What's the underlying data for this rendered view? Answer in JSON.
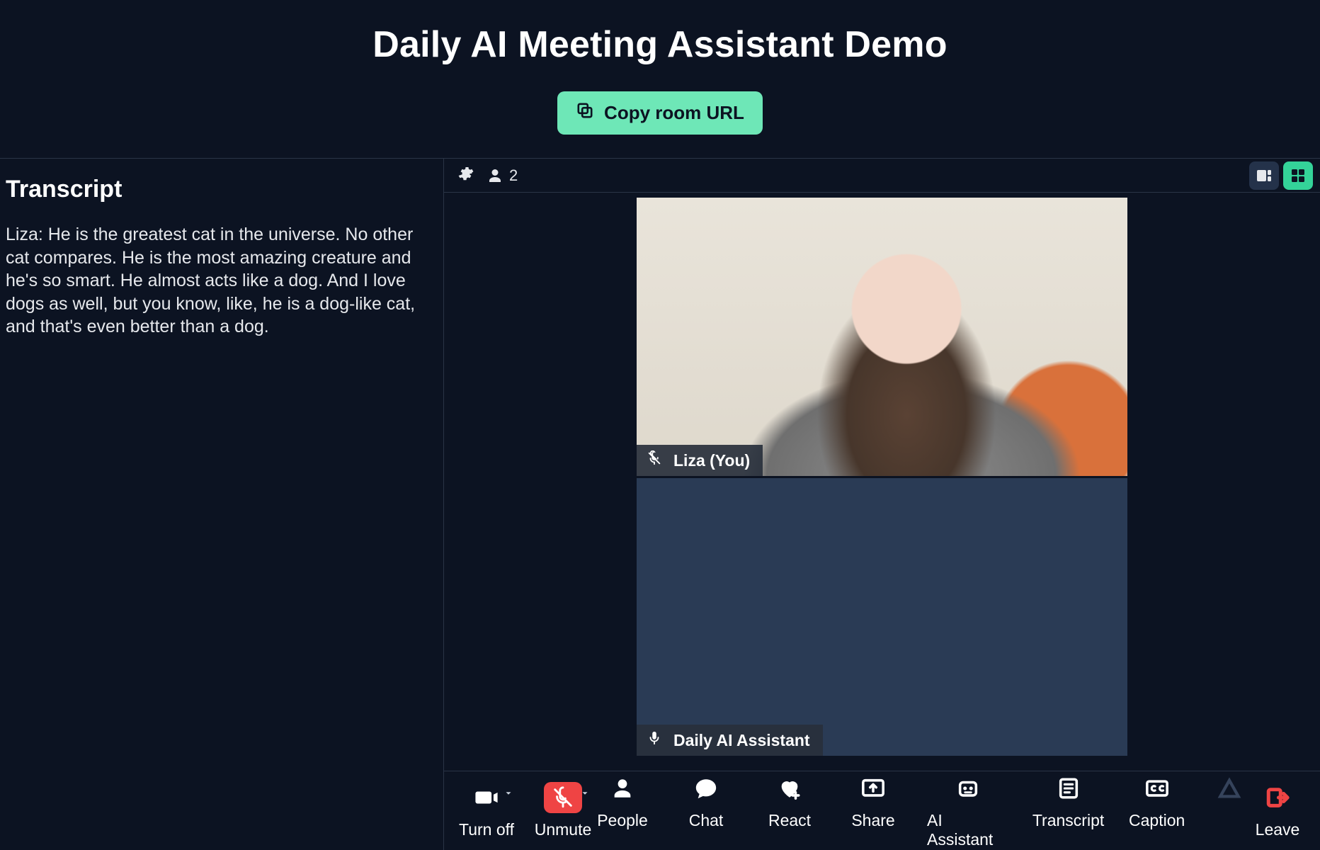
{
  "header": {
    "title": "Daily AI Meeting Assistant Demo",
    "copy_label": "Copy room URL"
  },
  "transcript": {
    "heading": "Transcript",
    "body": "Liza: He is the greatest cat in the universe. No other cat compares. He is the most amazing creature and he's so smart. He almost acts like a dog. And I love dogs as well, but you know, like, he is a dog-like cat, and that's even better than a dog."
  },
  "topbar": {
    "participant_count": "2"
  },
  "tiles": [
    {
      "participant_label": "Liza (You)",
      "muted": true
    },
    {
      "participant_label": "Daily AI Assistant",
      "muted": false
    }
  ],
  "controls": {
    "camera": "Turn off",
    "mic": "Unmute",
    "people": "People",
    "chat": "Chat",
    "react": "React",
    "share": "Share",
    "assistant": "AI Assistant",
    "transcript": "Transcript",
    "caption": "Caption",
    "leave": "Leave"
  }
}
